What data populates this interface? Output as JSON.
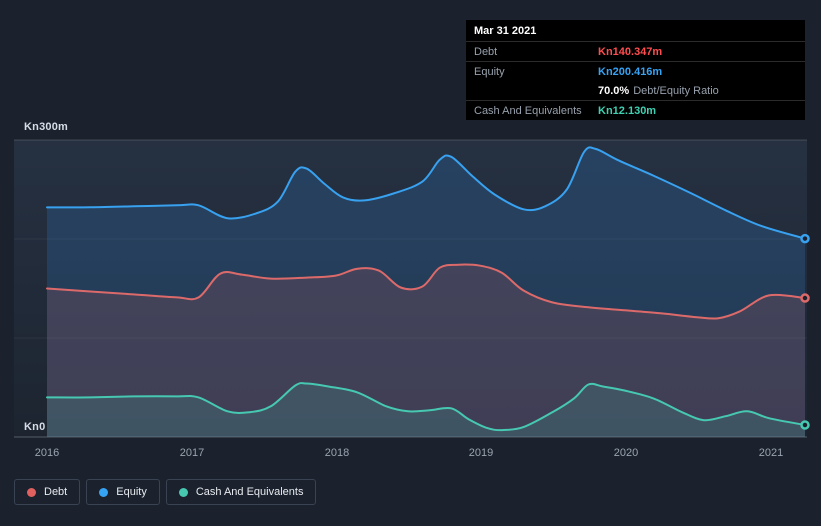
{
  "y_axis": {
    "top": "Kn300m",
    "bottom": "Kn0"
  },
  "x_axis": {
    "ticks": [
      "2016",
      "2017",
      "2018",
      "2019",
      "2020",
      "2021"
    ]
  },
  "tooltip": {
    "date": "Mar 31 2021",
    "debt_label": "Debt",
    "debt_value": "Kn140.347m",
    "equity_label": "Equity",
    "equity_value": "Kn200.416m",
    "ratio_value": "70.0%",
    "ratio_label": "Debt/Equity Ratio",
    "cash_label": "Cash And Equivalents",
    "cash_value": "Kn12.130m"
  },
  "legend": {
    "items": [
      {
        "label": "Debt",
        "color": "#e0605f"
      },
      {
        "label": "Equity",
        "color": "#36a3f5"
      },
      {
        "label": "Cash And Equivalents",
        "color": "#46c8b1"
      }
    ]
  },
  "chart_data": {
    "type": "area",
    "title": "Debt to Equity History",
    "y_unit": "Kn millions",
    "ylim": [
      0,
      300
    ],
    "x_domain": [
      2016,
      2021.25
    ],
    "x_ticks": [
      2016,
      2017,
      2018,
      2019,
      2020,
      2021
    ],
    "gridlines": [
      0,
      100,
      200,
      300
    ],
    "series": [
      {
        "name": "Equity",
        "color": "#38a1f0",
        "fill": "rgba(52,140,224,0.20)",
        "end_value": 200.416,
        "points": [
          [
            2016.0,
            232
          ],
          [
            2016.3,
            232
          ],
          [
            2016.6,
            233
          ],
          [
            2016.9,
            234
          ],
          [
            2017.05,
            234
          ],
          [
            2017.25,
            221
          ],
          [
            2017.45,
            226
          ],
          [
            2017.6,
            238
          ],
          [
            2017.72,
            268
          ],
          [
            2017.8,
            271
          ],
          [
            2017.92,
            256
          ],
          [
            2018.05,
            242
          ],
          [
            2018.2,
            239
          ],
          [
            2018.4,
            246
          ],
          [
            2018.6,
            258
          ],
          [
            2018.72,
            280
          ],
          [
            2018.8,
            283
          ],
          [
            2018.95,
            263
          ],
          [
            2019.1,
            245
          ],
          [
            2019.3,
            230
          ],
          [
            2019.45,
            233
          ],
          [
            2019.6,
            250
          ],
          [
            2019.72,
            288
          ],
          [
            2019.8,
            291
          ],
          [
            2019.95,
            280
          ],
          [
            2020.2,
            264
          ],
          [
            2020.45,
            247
          ],
          [
            2020.7,
            229
          ],
          [
            2020.95,
            213
          ],
          [
            2021.25,
            200.416
          ]
        ]
      },
      {
        "name": "Debt",
        "color": "#dd6a6a",
        "fill": "rgba(221,92,92,0.16)",
        "end_value": 140.347,
        "points": [
          [
            2016.0,
            150
          ],
          [
            2016.3,
            147
          ],
          [
            2016.6,
            144
          ],
          [
            2016.9,
            141
          ],
          [
            2017.05,
            141
          ],
          [
            2017.2,
            165
          ],
          [
            2017.35,
            164
          ],
          [
            2017.55,
            160
          ],
          [
            2017.8,
            161
          ],
          [
            2018.0,
            163
          ],
          [
            2018.15,
            170
          ],
          [
            2018.3,
            168
          ],
          [
            2018.45,
            151
          ],
          [
            2018.6,
            152
          ],
          [
            2018.72,
            171
          ],
          [
            2018.85,
            174
          ],
          [
            2019.0,
            173
          ],
          [
            2019.15,
            166
          ],
          [
            2019.3,
            148
          ],
          [
            2019.5,
            136
          ],
          [
            2019.75,
            131
          ],
          [
            2020.0,
            128
          ],
          [
            2020.25,
            125
          ],
          [
            2020.5,
            121
          ],
          [
            2020.65,
            120
          ],
          [
            2020.8,
            127
          ],
          [
            2021.0,
            143
          ],
          [
            2021.25,
            140.347
          ]
        ]
      },
      {
        "name": "Cash And Equivalents",
        "color": "#46c8b1",
        "fill": "rgba(70,200,177,0.16)",
        "end_value": 12.13,
        "points": [
          [
            2016.0,
            40
          ],
          [
            2016.3,
            40
          ],
          [
            2016.6,
            41
          ],
          [
            2016.9,
            41
          ],
          [
            2017.05,
            40
          ],
          [
            2017.25,
            26
          ],
          [
            2017.4,
            25
          ],
          [
            2017.55,
            31
          ],
          [
            2017.72,
            52
          ],
          [
            2017.8,
            54
          ],
          [
            2017.95,
            51
          ],
          [
            2018.15,
            45
          ],
          [
            2018.35,
            31
          ],
          [
            2018.5,
            26
          ],
          [
            2018.65,
            27
          ],
          [
            2018.8,
            29
          ],
          [
            2018.92,
            18
          ],
          [
            2019.05,
            9
          ],
          [
            2019.15,
            7
          ],
          [
            2019.3,
            10
          ],
          [
            2019.5,
            25
          ],
          [
            2019.65,
            39
          ],
          [
            2019.75,
            53
          ],
          [
            2019.85,
            51
          ],
          [
            2020.0,
            47
          ],
          [
            2020.2,
            39
          ],
          [
            2020.4,
            25
          ],
          [
            2020.55,
            17
          ],
          [
            2020.7,
            21
          ],
          [
            2020.85,
            26
          ],
          [
            2021.0,
            19
          ],
          [
            2021.25,
            12.13
          ]
        ]
      }
    ]
  }
}
